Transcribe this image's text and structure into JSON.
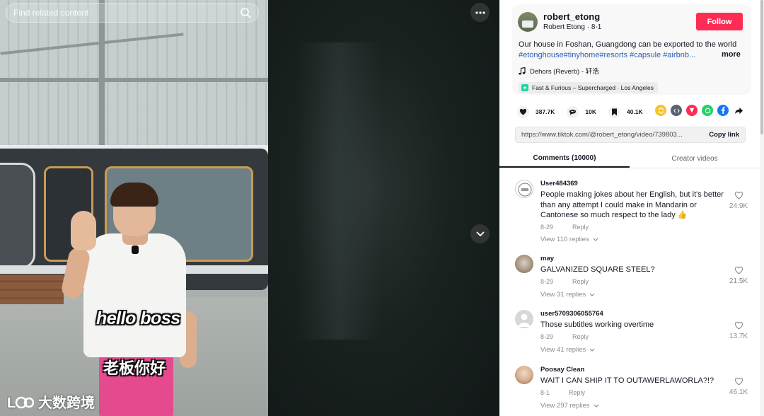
{
  "video": {
    "search_placeholder": "Find related content",
    "subtitle_en": "hello boss",
    "subtitle_zh": "老板你好",
    "watermark_text": "大数跨境",
    "more_icon": "ellipsis-icon",
    "next_icon": "chevron-down-icon"
  },
  "author": {
    "username": "robert_etong",
    "display_name": "Robert Etong",
    "date": "8-1",
    "follow_label": "Follow"
  },
  "description": {
    "text": "Our house in Foshan, Guangdong can be exported to the world",
    "tags": "#etonghouse#tinyhome#resorts #capsule #airbnb...",
    "more_label": "more",
    "music": "Dehors (Reverb) - 轩浩",
    "effect": "Fast & Furious – Supercharged · Los Angeles"
  },
  "stats": {
    "likes": "387.7K",
    "comments": "10K",
    "saves": "40.1K"
  },
  "share": {
    "link": "https://www.tiktok.com/@robert_etong/video/739803...",
    "copy_label": "Copy link"
  },
  "tabs": [
    {
      "label": "Comments (10000)",
      "active": true
    },
    {
      "label": "Creator videos",
      "active": false
    }
  ],
  "comments": [
    {
      "user": "User484369",
      "text": "People making jokes about her English, but it's better than any attempt I could make in Mandarin or Cantonese so much respect to the lady 👍",
      "date": "8-29",
      "reply_label": "Reply",
      "replies": "View 110 replies",
      "likes": "24.9K"
    },
    {
      "user": "may",
      "text": "GALVANIZED SQUARE STEEL?",
      "date": "8-29",
      "reply_label": "Reply",
      "replies": "View 31 replies",
      "likes": "21.5K"
    },
    {
      "user": "user5709306055764",
      "text": "Those subtitles working overtime",
      "date": "8-29",
      "reply_label": "Reply",
      "replies": "View 41 replies",
      "likes": "13.7K"
    },
    {
      "user": "Poosay Clean",
      "text": "WAIT I CAN SHIP IT TO OUTAWERLAWORLA?!?",
      "date": "8-1",
      "reply_label": "Reply",
      "replies": "View 297 replies",
      "likes": "46.1K"
    }
  ],
  "colors": {
    "follow": "#fe2c55",
    "hashtag": "#2b5db9",
    "stage_bg": "#101616"
  }
}
